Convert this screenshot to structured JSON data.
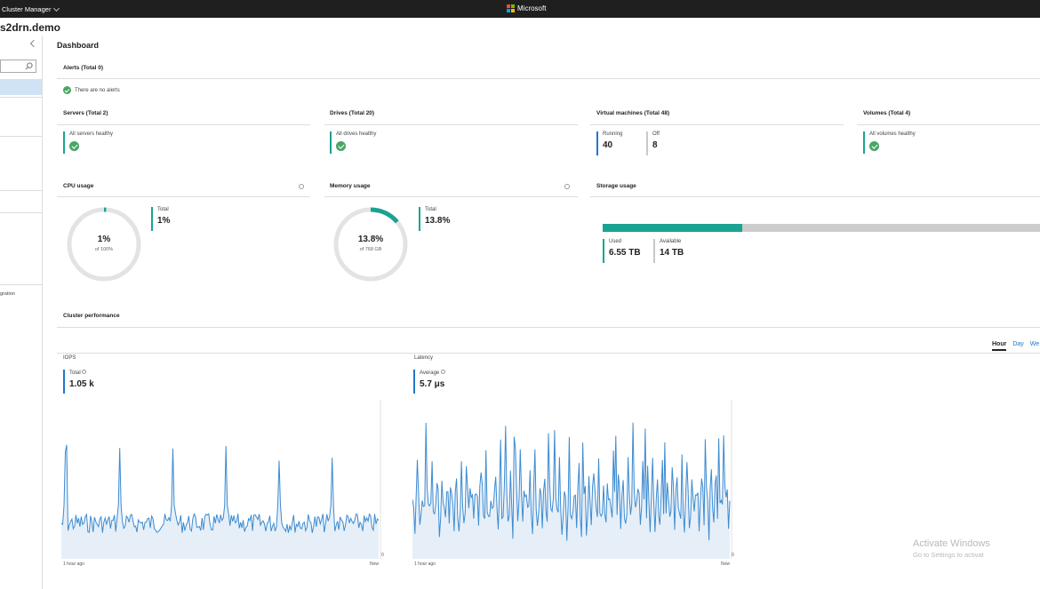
{
  "topbar": {
    "app_name": "Cluster Manager",
    "brand": "Microsoft"
  },
  "host": "s2drn.demo",
  "nav": {
    "partial_item": "gration"
  },
  "dashboard": {
    "title": "Dashboard",
    "alerts": {
      "title": "Alerts (Total 0)",
      "message": "There are no alerts"
    },
    "servers": {
      "title": "Servers   (Total 2)",
      "status": "All servers healthy"
    },
    "drives": {
      "title": "Drives   (Total 20)",
      "status": "All drives healthy"
    },
    "vms": {
      "title": "Virtual machines   (Total 48)",
      "running_label": "Running",
      "running": "40",
      "off_label": "Off",
      "off": "8"
    },
    "volumes": {
      "title": "Volumes   (Total 4)",
      "status": "All volumes healthy"
    },
    "cpu": {
      "title": "CPU usage",
      "center": "1%",
      "sub": "of 100%",
      "total_label": "Total",
      "total": "1%",
      "fraction": 0.01
    },
    "memory": {
      "title": "Memory usage",
      "center": "13.8%",
      "sub": "of 768 GB",
      "total_label": "Total",
      "total": "13.8%",
      "fraction": 0.138
    },
    "storage": {
      "title": "Storage usage",
      "used_label": "Used",
      "used": "6.55 TB",
      "avail_label": "Available",
      "avail": "14 TB",
      "used_fraction": 0.319
    },
    "perf": {
      "title": "Cluster performance",
      "tabs": [
        "Hour",
        "Day",
        "We"
      ],
      "iops": {
        "title": "IOPS",
        "stat_label": "Total",
        "stat": "1.05 k",
        "x_start": "1 hour ago",
        "x_end": "Now",
        "y_min": "0"
      },
      "latency": {
        "title": "Latency",
        "stat_label": "Average",
        "stat": "5.7 μs",
        "x_start": "1 hour ago",
        "x_end": "Now",
        "y_min": "0"
      }
    }
  },
  "watermark": {
    "line1": "Activate Windows",
    "line2": "Go to Settings to activat"
  },
  "colors": {
    "teal": "#1aa390",
    "blue": "#1e78c8",
    "healthy": "#4aa564",
    "ring_bg": "#e3e3e3"
  }
}
